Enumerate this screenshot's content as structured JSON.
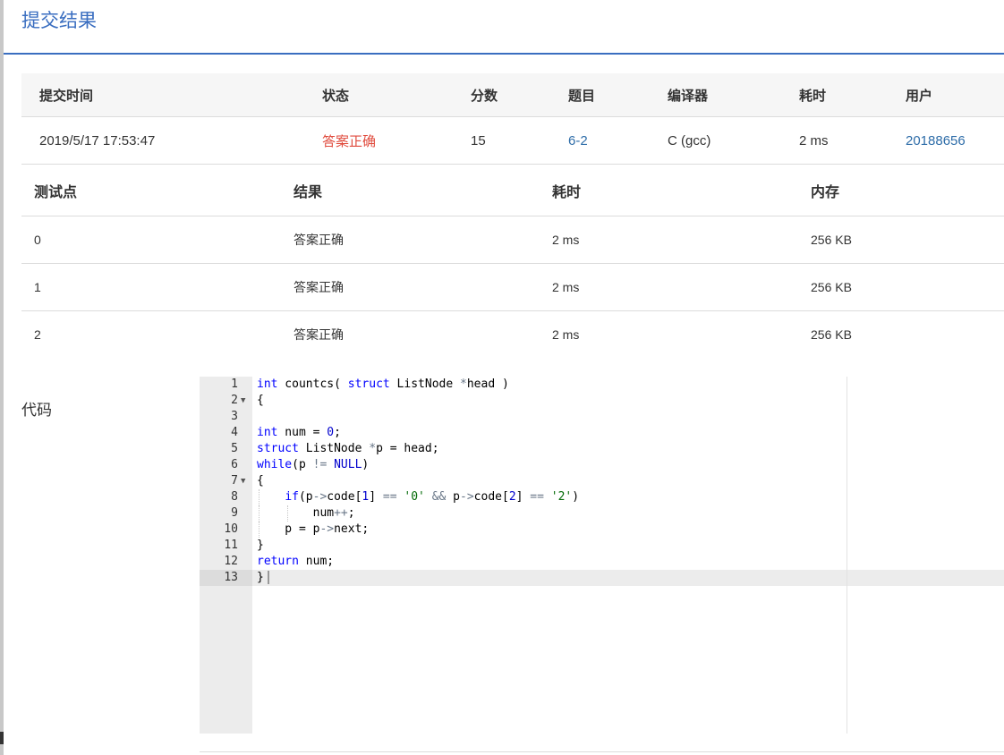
{
  "page": {
    "title": "提交结果"
  },
  "summary": {
    "headers": [
      "提交时间",
      "状态",
      "分数",
      "题目",
      "编译器",
      "耗时",
      "用户"
    ],
    "row": {
      "time": "2019/5/17 17:53:47",
      "status": "答案正确",
      "score": "15",
      "problem": "6-2",
      "compiler": "C (gcc)",
      "duration": "2 ms",
      "user": "20188656"
    }
  },
  "tests": {
    "headers": [
      "测试点",
      "结果",
      "耗时",
      "内存"
    ],
    "rows": [
      {
        "id": "0",
        "result": "答案正确",
        "time": "2 ms",
        "memory": "256 KB"
      },
      {
        "id": "1",
        "result": "答案正确",
        "time": "2 ms",
        "memory": "256 KB"
      },
      {
        "id": "2",
        "result": "答案正确",
        "time": "2 ms",
        "memory": "256 KB"
      }
    ]
  },
  "code": {
    "label": "代码",
    "lines": [
      "int countcs( struct ListNode *head )",
      "{",
      "",
      "int num = 0;",
      "struct ListNode *p = head;",
      "while(p != NULL)",
      "{",
      "    if(p->code[1] == '0' && p->code[2] == '2')",
      "        num++;",
      "    p = p->next;",
      "}",
      "return num;",
      "}"
    ],
    "line_numbers": [
      "1",
      "2",
      "3",
      "4",
      "5",
      "6",
      "7",
      "8",
      "9",
      "10",
      "11",
      "12",
      "13"
    ]
  },
  "colors": {
    "accent": "#3a6ec0",
    "success": "#e04a3c",
    "link": "#2d6ca8"
  }
}
